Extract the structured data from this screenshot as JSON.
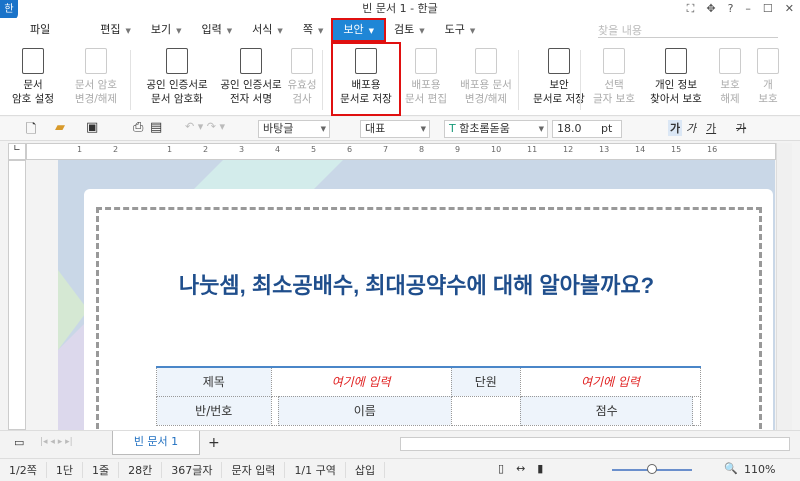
{
  "window": {
    "title": "빈 문서 1 - 한글",
    "logo": "한",
    "controls": [
      "⛶",
      "✥",
      "?",
      "–",
      "☐",
      "✕"
    ]
  },
  "menu": [
    {
      "label": "파일",
      "arrow": false
    },
    {
      "label": "편집",
      "arrow": true
    },
    {
      "label": "보기",
      "arrow": true
    },
    {
      "label": "입력",
      "arrow": true
    },
    {
      "label": "서식",
      "arrow": true
    },
    {
      "label": "쪽",
      "arrow": true
    },
    {
      "label": "보안",
      "arrow": true,
      "active": true
    },
    {
      "label": "검토",
      "arrow": true
    },
    {
      "label": "도구",
      "arrow": true
    }
  ],
  "search": {
    "placeholder": "찾을 내용"
  },
  "ribbon": [
    {
      "l1": "문서",
      "l2": "암호 설정",
      "enabled": true
    },
    {
      "l1": "문서 암호",
      "l2": "변경/해제",
      "enabled": false
    },
    {
      "l1": "공인 인증서로",
      "l2": "문서 암호화",
      "enabled": true
    },
    {
      "l1": "공인 인증서로",
      "l2": "전자 서명",
      "enabled": true
    },
    {
      "l1": "유효성",
      "l2": "검사",
      "enabled": false
    },
    {
      "l1": "배포용",
      "l2": "문서로 저장",
      "enabled": true,
      "highlighted": true
    },
    {
      "l1": "배포용",
      "l2": "문서 편집",
      "enabled": false
    },
    {
      "l1": "배포용 문서",
      "l2": "변경/해제",
      "enabled": false
    },
    {
      "l1": "보안",
      "l2": "문서로 저장",
      "enabled": true
    },
    {
      "l1": "선택",
      "l2": "글자 보호",
      "enabled": false
    },
    {
      "l1": "개인 정보",
      "l2": "찾아서 보호",
      "enabled": true
    },
    {
      "l1": "보호",
      "l2": "해제",
      "enabled": false
    },
    {
      "l1": "개",
      "l2": "보호",
      "enabled": false
    }
  ],
  "toolbar": {
    "style": "바탕글",
    "lang": "대표",
    "font": "함초롬돋움",
    "size": "18.0",
    "unit": "pt",
    "fmt": [
      "가",
      "가",
      "가",
      "가"
    ]
  },
  "ruler": {
    "ticks": [
      "2",
      "1",
      "1",
      "2",
      "3",
      "4",
      "5",
      "6",
      "7",
      "8",
      "9",
      "10",
      "11",
      "12",
      "13",
      "14",
      "15",
      "16"
    ]
  },
  "document": {
    "title": "나눗셈, 최소공배수, 최대공약수에 대해 알아볼까요?",
    "table": {
      "r1": [
        "제목",
        "여기에 입력",
        "단원",
        "여기에 입력"
      ],
      "r2": [
        "반/번호",
        "",
        "이름",
        "",
        "점수",
        ""
      ]
    }
  },
  "tabs": {
    "doc": "빈 문서 1",
    "add": "+"
  },
  "status": {
    "page": "1/2쪽",
    "col": "1단",
    "line": "1줄",
    "pos": "28칸",
    "chars": "367글자",
    "mode": "문자 입력",
    "section": "1/1 구역",
    "insert": "삽입",
    "zoom": "110%",
    "zoom_level": 0.5
  },
  "colors": {
    "accent": "#1f86d6",
    "title": "#1f4e8c",
    "highlight": "#e01010"
  }
}
